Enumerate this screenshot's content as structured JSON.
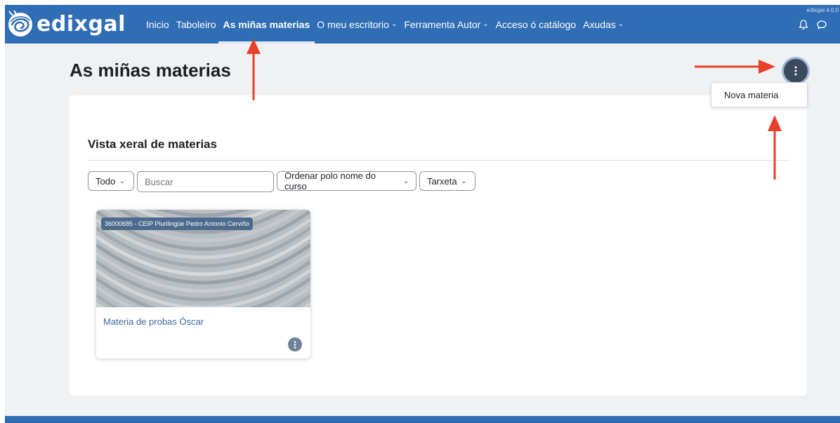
{
  "header": {
    "logo_text": "edixgal",
    "version": "edixgal 4.0.0",
    "nav": [
      {
        "label": "Inicio",
        "has_caret": false,
        "active": false
      },
      {
        "label": "Taboleiro",
        "has_caret": false,
        "active": false
      },
      {
        "label": "As miñas materias",
        "has_caret": false,
        "active": true
      },
      {
        "label": "O meu escritorio",
        "has_caret": true,
        "active": false
      },
      {
        "label": "Ferramenta Autor",
        "has_caret": true,
        "active": false
      },
      {
        "label": "Acceso ó catálogo",
        "has_caret": false,
        "active": false
      },
      {
        "label": "Axudas",
        "has_caret": true,
        "active": false
      }
    ],
    "icons": [
      "bell-icon",
      "chat-icon"
    ]
  },
  "page": {
    "title": "As miñas materias",
    "actions_menu": {
      "icon": "kebab-icon",
      "items": [
        "Nova materia"
      ]
    }
  },
  "overview": {
    "title": "Vista xeral de materias",
    "filters": {
      "grouping": "Todo",
      "search_placeholder": "Buscar",
      "sort": "Ordenar polo nome do curso",
      "view": "Tarxeta"
    },
    "courses": [
      {
        "category": "36000685 - CEIP Plurilingüe Pedro Antonio Cerviño",
        "name": "Materia de probas Óscar",
        "menu_icon": "kebab-icon"
      }
    ]
  },
  "annotations": {
    "arrow_color": "#e8412a"
  },
  "colors": {
    "navbar": "#2f6db5",
    "page_bg": "#f0f1f3",
    "badge": "#4b6a8c",
    "link": "#3d6a9b"
  }
}
